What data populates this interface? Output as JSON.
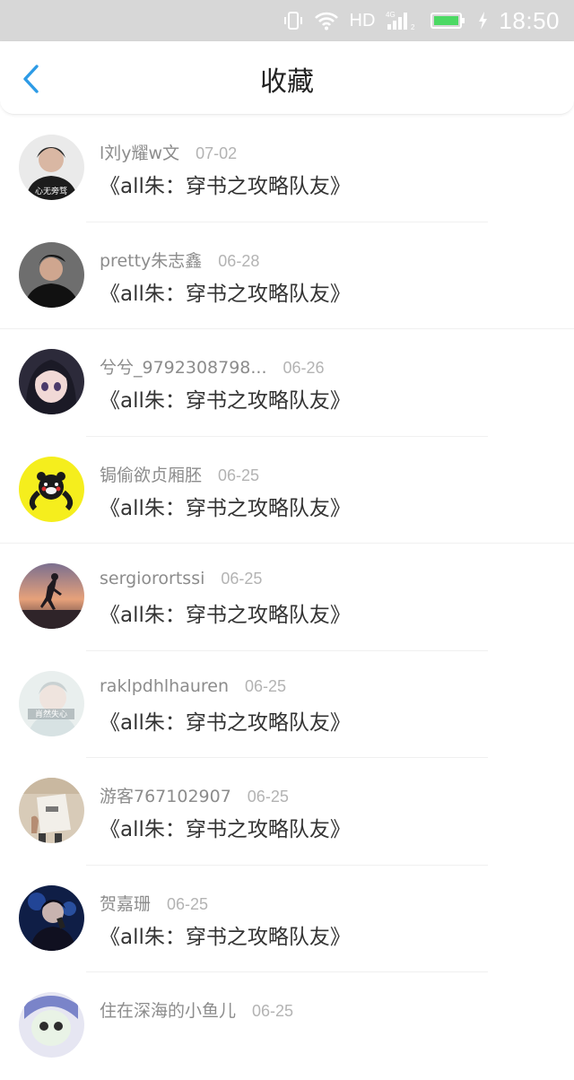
{
  "status": {
    "hd": "HD",
    "signal_tag": "4G",
    "sim_slot": "2",
    "time": "18:50",
    "battery_color": "#4cd964"
  },
  "header": {
    "title": "收藏",
    "back_icon": "chevron-left-icon",
    "accent": "#2d9be6"
  },
  "favorites": [
    {
      "name": "l刘y耀w文",
      "date": "07-02",
      "book": "《all朱：穿书之攻略队友》"
    },
    {
      "name": "pretty朱志鑫",
      "date": "06-28",
      "book": "《all朱：穿书之攻略队友》"
    },
    {
      "name": "兮兮_9792308798...",
      "date": "06-26",
      "book": "《all朱：穿书之攻略队友》"
    },
    {
      "name": "锔偷欲贞厢胚",
      "date": "06-25",
      "book": "《all朱：穿书之攻略队友》"
    },
    {
      "name": "sergiorortssi",
      "date": "06-25",
      "book": "《all朱：穿书之攻略队友》"
    },
    {
      "name": "raklpdhlhauren",
      "date": "06-25",
      "book": "《all朱：穿书之攻略队友》"
    },
    {
      "name": "游客767102907",
      "date": "06-25",
      "book": "《all朱：穿书之攻略队友》"
    },
    {
      "name": "贺嘉珊",
      "date": "06-25",
      "book": "《all朱：穿书之攻略队友》"
    },
    {
      "name": "住在深海的小鱼儿",
      "date": "06-25",
      "book": ""
    }
  ],
  "avatar_texts": {
    "a1": "心无旁骛",
    "a6": "肖然失心"
  }
}
